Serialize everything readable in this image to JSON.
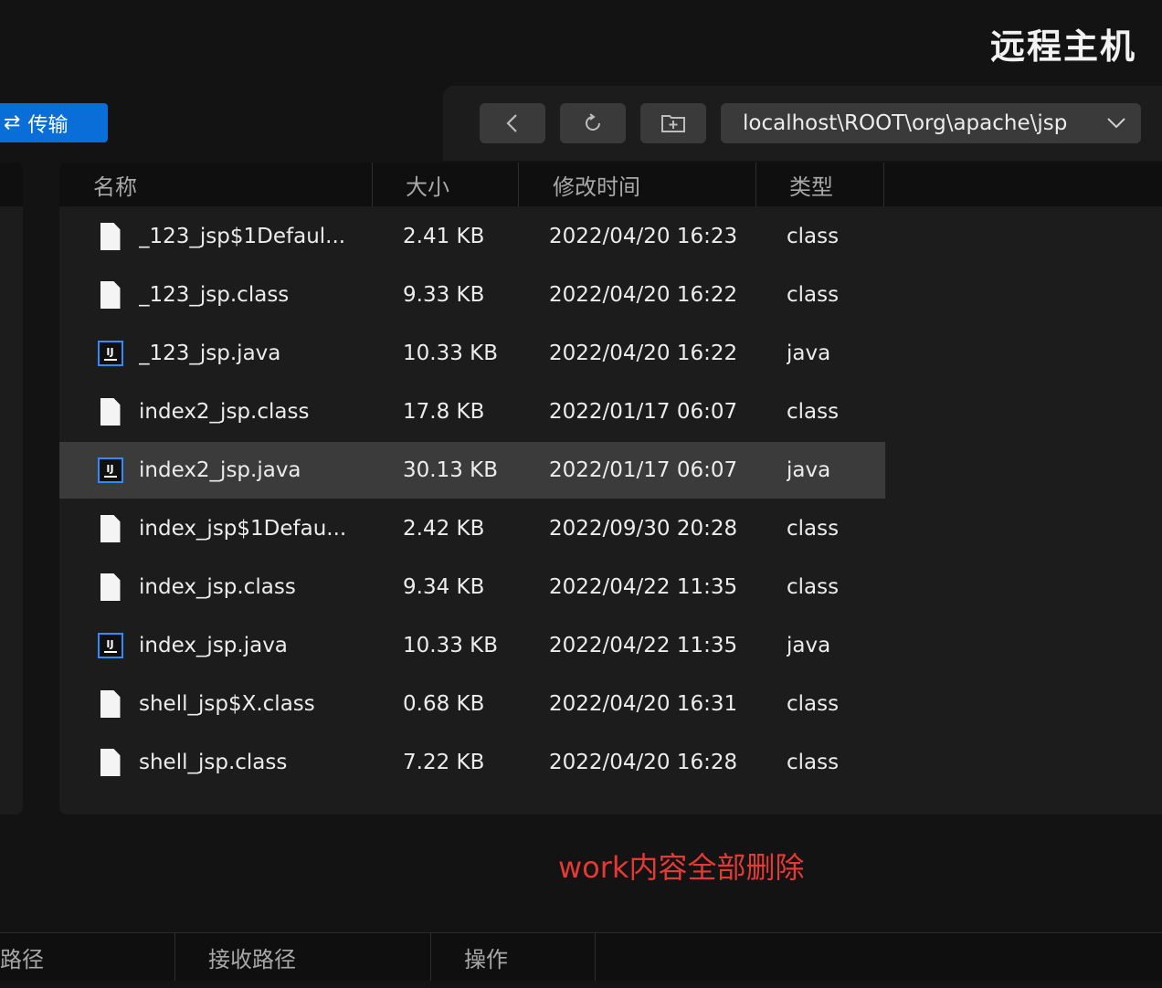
{
  "window": {
    "title": "远程主机"
  },
  "toolbar": {
    "transfer_label": "传输",
    "transfer_icon": "sync-icon",
    "back_icon": "chevron-left-icon",
    "refresh_icon": "refresh-icon",
    "new_folder_icon": "folder-plus-icon",
    "path": "localhost\\ROOT\\org\\apache\\jsp",
    "path_dropdown_icon": "chevron-down-icon"
  },
  "file_table": {
    "columns": [
      "名称",
      "大小",
      "修改时间",
      "类型"
    ],
    "rows": [
      {
        "icon": "file",
        "name": "_123_jsp$1Defaul...",
        "size": "2.41 KB",
        "modified": "2022/04/20 16:23",
        "type": "class"
      },
      {
        "icon": "file",
        "name": "_123_jsp.class",
        "size": "9.33 KB",
        "modified": "2022/04/20 16:22",
        "type": "class"
      },
      {
        "icon": "intellij",
        "name": "_123_jsp.java",
        "size": "10.33 KB",
        "modified": "2022/04/20 16:22",
        "type": "java"
      },
      {
        "icon": "file",
        "name": "index2_jsp.class",
        "size": "17.8 KB",
        "modified": "2022/01/17 06:07",
        "type": "class"
      },
      {
        "icon": "intellij",
        "name": "index2_jsp.java",
        "size": "30.13 KB",
        "modified": "2022/01/17 06:07",
        "type": "java",
        "selected": true
      },
      {
        "icon": "file",
        "name": "index_jsp$1Defau...",
        "size": "2.42 KB",
        "modified": "2022/09/30 20:28",
        "type": "class"
      },
      {
        "icon": "file",
        "name": "index_jsp.class",
        "size": "9.34 KB",
        "modified": "2022/04/22 11:35",
        "type": "class"
      },
      {
        "icon": "intellij",
        "name": "index_jsp.java",
        "size": "10.33 KB",
        "modified": "2022/04/22 11:35",
        "type": "java"
      },
      {
        "icon": "file",
        "name": "shell_jsp$X.class",
        "size": "0.68 KB",
        "modified": "2022/04/20 16:31",
        "type": "class"
      },
      {
        "icon": "file",
        "name": "shell_jsp.class",
        "size": "7.22 KB",
        "modified": "2022/04/20 16:28",
        "type": "class"
      }
    ]
  },
  "annotation": {
    "text": "work内容全部删除",
    "color": "#e53935"
  },
  "transfer_table": {
    "columns": [
      "路径",
      "接收路径",
      "操作"
    ]
  },
  "colors": {
    "accent": "#0a6ed8",
    "selected_row": "#3b3b3b",
    "ij_icon_border": "#2f8cff"
  }
}
